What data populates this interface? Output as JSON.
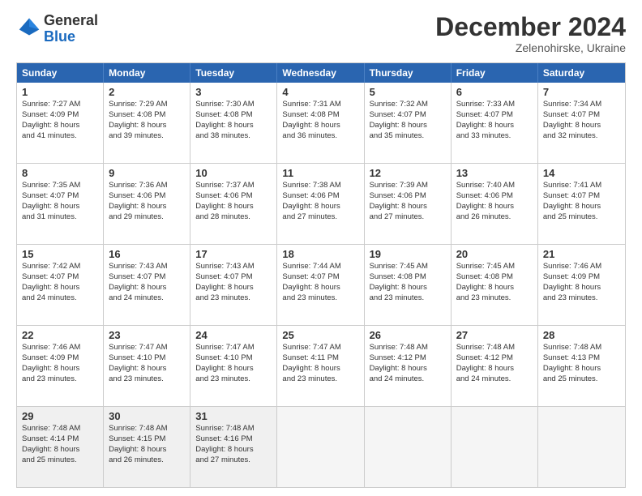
{
  "logo": {
    "general": "General",
    "blue": "Blue"
  },
  "header": {
    "month": "December 2024",
    "location": "Zelenohirske, Ukraine"
  },
  "days": [
    "Sunday",
    "Monday",
    "Tuesday",
    "Wednesday",
    "Thursday",
    "Friday",
    "Saturday"
  ],
  "rows": [
    [
      {
        "day": "1",
        "lines": [
          "Sunrise: 7:27 AM",
          "Sunset: 4:09 PM",
          "Daylight: 8 hours",
          "and 41 minutes."
        ]
      },
      {
        "day": "2",
        "lines": [
          "Sunrise: 7:29 AM",
          "Sunset: 4:08 PM",
          "Daylight: 8 hours",
          "and 39 minutes."
        ]
      },
      {
        "day": "3",
        "lines": [
          "Sunrise: 7:30 AM",
          "Sunset: 4:08 PM",
          "Daylight: 8 hours",
          "and 38 minutes."
        ]
      },
      {
        "day": "4",
        "lines": [
          "Sunrise: 7:31 AM",
          "Sunset: 4:08 PM",
          "Daylight: 8 hours",
          "and 36 minutes."
        ]
      },
      {
        "day": "5",
        "lines": [
          "Sunrise: 7:32 AM",
          "Sunset: 4:07 PM",
          "Daylight: 8 hours",
          "and 35 minutes."
        ]
      },
      {
        "day": "6",
        "lines": [
          "Sunrise: 7:33 AM",
          "Sunset: 4:07 PM",
          "Daylight: 8 hours",
          "and 33 minutes."
        ]
      },
      {
        "day": "7",
        "lines": [
          "Sunrise: 7:34 AM",
          "Sunset: 4:07 PM",
          "Daylight: 8 hours",
          "and 32 minutes."
        ]
      }
    ],
    [
      {
        "day": "8",
        "lines": [
          "Sunrise: 7:35 AM",
          "Sunset: 4:07 PM",
          "Daylight: 8 hours",
          "and 31 minutes."
        ]
      },
      {
        "day": "9",
        "lines": [
          "Sunrise: 7:36 AM",
          "Sunset: 4:06 PM",
          "Daylight: 8 hours",
          "and 29 minutes."
        ]
      },
      {
        "day": "10",
        "lines": [
          "Sunrise: 7:37 AM",
          "Sunset: 4:06 PM",
          "Daylight: 8 hours",
          "and 28 minutes."
        ]
      },
      {
        "day": "11",
        "lines": [
          "Sunrise: 7:38 AM",
          "Sunset: 4:06 PM",
          "Daylight: 8 hours",
          "and 27 minutes."
        ]
      },
      {
        "day": "12",
        "lines": [
          "Sunrise: 7:39 AM",
          "Sunset: 4:06 PM",
          "Daylight: 8 hours",
          "and 27 minutes."
        ]
      },
      {
        "day": "13",
        "lines": [
          "Sunrise: 7:40 AM",
          "Sunset: 4:06 PM",
          "Daylight: 8 hours",
          "and 26 minutes."
        ]
      },
      {
        "day": "14",
        "lines": [
          "Sunrise: 7:41 AM",
          "Sunset: 4:07 PM",
          "Daylight: 8 hours",
          "and 25 minutes."
        ]
      }
    ],
    [
      {
        "day": "15",
        "lines": [
          "Sunrise: 7:42 AM",
          "Sunset: 4:07 PM",
          "Daylight: 8 hours",
          "and 24 minutes."
        ]
      },
      {
        "day": "16",
        "lines": [
          "Sunrise: 7:43 AM",
          "Sunset: 4:07 PM",
          "Daylight: 8 hours",
          "and 24 minutes."
        ]
      },
      {
        "day": "17",
        "lines": [
          "Sunrise: 7:43 AM",
          "Sunset: 4:07 PM",
          "Daylight: 8 hours",
          "and 23 minutes."
        ]
      },
      {
        "day": "18",
        "lines": [
          "Sunrise: 7:44 AM",
          "Sunset: 4:07 PM",
          "Daylight: 8 hours",
          "and 23 minutes."
        ]
      },
      {
        "day": "19",
        "lines": [
          "Sunrise: 7:45 AM",
          "Sunset: 4:08 PM",
          "Daylight: 8 hours",
          "and 23 minutes."
        ]
      },
      {
        "day": "20",
        "lines": [
          "Sunrise: 7:45 AM",
          "Sunset: 4:08 PM",
          "Daylight: 8 hours",
          "and 23 minutes."
        ]
      },
      {
        "day": "21",
        "lines": [
          "Sunrise: 7:46 AM",
          "Sunset: 4:09 PM",
          "Daylight: 8 hours",
          "and 23 minutes."
        ]
      }
    ],
    [
      {
        "day": "22",
        "lines": [
          "Sunrise: 7:46 AM",
          "Sunset: 4:09 PM",
          "Daylight: 8 hours",
          "and 23 minutes."
        ]
      },
      {
        "day": "23",
        "lines": [
          "Sunrise: 7:47 AM",
          "Sunset: 4:10 PM",
          "Daylight: 8 hours",
          "and 23 minutes."
        ]
      },
      {
        "day": "24",
        "lines": [
          "Sunrise: 7:47 AM",
          "Sunset: 4:10 PM",
          "Daylight: 8 hours",
          "and 23 minutes."
        ]
      },
      {
        "day": "25",
        "lines": [
          "Sunrise: 7:47 AM",
          "Sunset: 4:11 PM",
          "Daylight: 8 hours",
          "and 23 minutes."
        ]
      },
      {
        "day": "26",
        "lines": [
          "Sunrise: 7:48 AM",
          "Sunset: 4:12 PM",
          "Daylight: 8 hours",
          "and 24 minutes."
        ]
      },
      {
        "day": "27",
        "lines": [
          "Sunrise: 7:48 AM",
          "Sunset: 4:12 PM",
          "Daylight: 8 hours",
          "and 24 minutes."
        ]
      },
      {
        "day": "28",
        "lines": [
          "Sunrise: 7:48 AM",
          "Sunset: 4:13 PM",
          "Daylight: 8 hours",
          "and 25 minutes."
        ]
      }
    ],
    [
      {
        "day": "29",
        "lines": [
          "Sunrise: 7:48 AM",
          "Sunset: 4:14 PM",
          "Daylight: 8 hours",
          "and 25 minutes."
        ]
      },
      {
        "day": "30",
        "lines": [
          "Sunrise: 7:48 AM",
          "Sunset: 4:15 PM",
          "Daylight: 8 hours",
          "and 26 minutes."
        ]
      },
      {
        "day": "31",
        "lines": [
          "Sunrise: 7:48 AM",
          "Sunset: 4:16 PM",
          "Daylight: 8 hours",
          "and 27 minutes."
        ]
      },
      null,
      null,
      null,
      null
    ]
  ]
}
